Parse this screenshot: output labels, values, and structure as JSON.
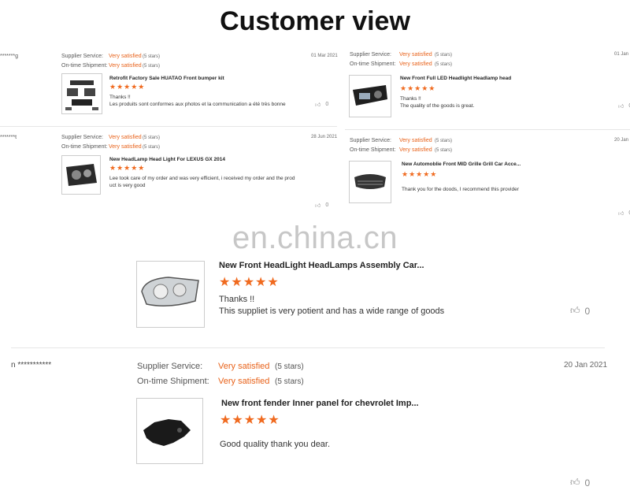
{
  "title": "Customer view",
  "watermark": "en.china.cn",
  "labels": {
    "supplier_service": "Supplier Service:",
    "ontime_shipment": "On-time Shipment:",
    "very_satisfied": "Very satisfied",
    "five_stars": "(5 stars)",
    "stars": "★★★★★"
  },
  "reviews": [
    {
      "user": "*******g",
      "date": "01 Mar 2021",
      "product": "Retrofit Factory Sale HUATAO Front bumper kit",
      "line1": "Thanks !!",
      "line2": "Les produits sont conformes aux photos et la communication a été très bonne",
      "likes": "0"
    },
    {
      "user": "*******t",
      "date": "28 Jun 2021",
      "product": "New HeadLamp Head Light For LEXUS GX 2014",
      "line1": "Lee took care of my order and was very efficient, i received my order and the prod",
      "line2": "uct is very good",
      "likes": "0"
    },
    {
      "user": "",
      "date": "01 Jan",
      "product": "New Front Full LED Headlight Headlamp head",
      "line1": "Thanks !!",
      "line2": "The quality of the goods is great.",
      "likes": "0"
    },
    {
      "user": "",
      "date": "20 Jan",
      "product": "New Automoblie Front MID Grille Grill Car Acce...",
      "line1": "Thank you for the doods, I recommend this provider",
      "line2": "",
      "likes": "0"
    },
    {
      "product": "New Front HeadLight HeadLamps Assembly Car...",
      "line1": "Thanks !!",
      "line2": "This suppliet is very potient and has a wide range of goods",
      "likes": "0"
    },
    {
      "user": "n ***********",
      "date": "20 Jan 2021",
      "product": "New front fender Inner panel for chevrolet Imp...",
      "line1": "Good quality thank you dear.",
      "likes": "0"
    }
  ]
}
